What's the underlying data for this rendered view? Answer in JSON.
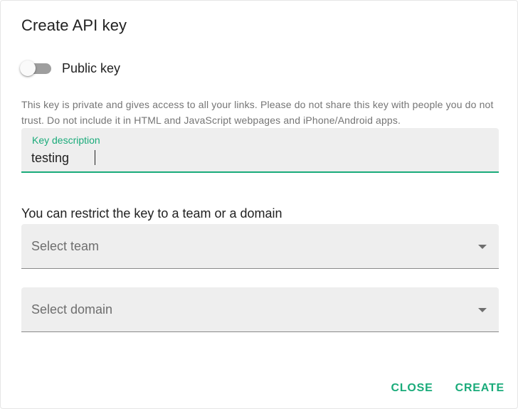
{
  "dialog": {
    "title": "Create API key",
    "public_key_toggle": {
      "label": "Public key",
      "checked": false
    },
    "hint": "This key is private and gives access to all your links. Please do not share this key with people you do not trust. Do not include it in HTML and JavaScript webpages and iPhone/Android apps.",
    "key_description": {
      "label": "Key description",
      "value": "testing"
    },
    "restrict_label": "You can restrict the key to a team or a domain",
    "team_select": {
      "placeholder": "Select team"
    },
    "domain_select": {
      "placeholder": "Select domain"
    },
    "buttons": {
      "close": "CLOSE",
      "create": "CREATE"
    }
  },
  "colors": {
    "accent": "#1aab7a",
    "field_bg": "#eeeeee",
    "text": "#212121",
    "hint_text": "#757575",
    "toggle_track_off": "#9e9e9e"
  },
  "icons": {
    "select_arrow": "chevron-down-icon"
  }
}
